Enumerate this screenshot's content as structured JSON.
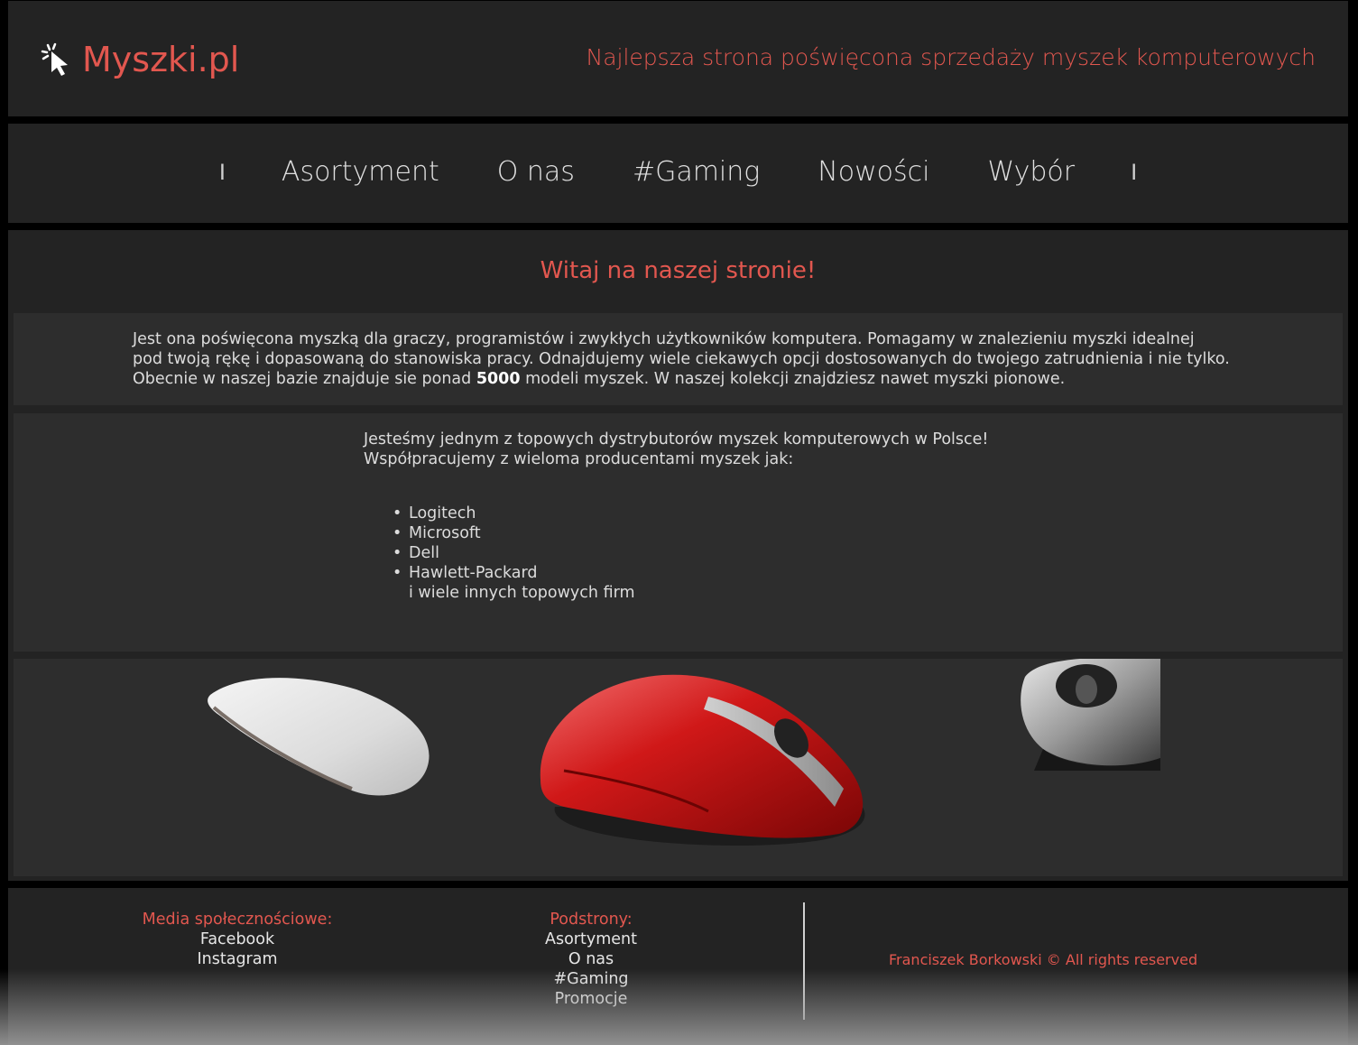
{
  "header": {
    "logo_text": "Myszki.pl",
    "tagline": "Najlepsza strona poświęcona sprzedaży myszek komputerowych",
    "logo_icon": "cursor-click-icon"
  },
  "nav": {
    "separator": "I",
    "items": [
      "Asortyment",
      "O nas",
      "#Gaming",
      "Nowości",
      "Wybór"
    ]
  },
  "main": {
    "title": "Witaj na naszej stronie!",
    "intro_lines": [
      "Jest ona poświęcona myszką dla graczy, programistów i zwykłych użytkowników komputera. Pomagamy w znalezieniu myszki idealnej",
      "pod twoją rękę i dopasowaną do stanowiska pracy. Odnajdujemy wiele ciekawych opcji dostosowanych do twojego zatrudnienia i nie tylko."
    ],
    "intro_line3_pre": "Obecnie w naszej bazie znajduje sie ponad ",
    "intro_count": "5000",
    "intro_line3_post": " modeli myszek. W naszej kolekcji znajdziesz nawet myszki pionowe.",
    "partners_line1": "Jesteśmy jednym z topowych dystrybutorów myszek komputerowych w Polsce!",
    "partners_line2": "Współpracujemy z wieloma producentami myszek jak:",
    "partners": [
      "Logitech",
      "Microsoft",
      "Dell",
      "Hawlett-Packard"
    ],
    "partners_more": "i wiele innych topowych firm"
  },
  "footer": {
    "social_heading": "Media społecznościowe:",
    "social_links": [
      "Facebook",
      "Instagram"
    ],
    "pages_heading": "Podstrony:",
    "pages_links": [
      "Asortyment",
      "O nas",
      "#Gaming",
      "Promocje"
    ],
    "copyright": "Franciszek Borkowski © All rights reserved"
  },
  "colors": {
    "accent": "#e2574f",
    "panel": "#232323",
    "box": "#2d2d2d"
  }
}
